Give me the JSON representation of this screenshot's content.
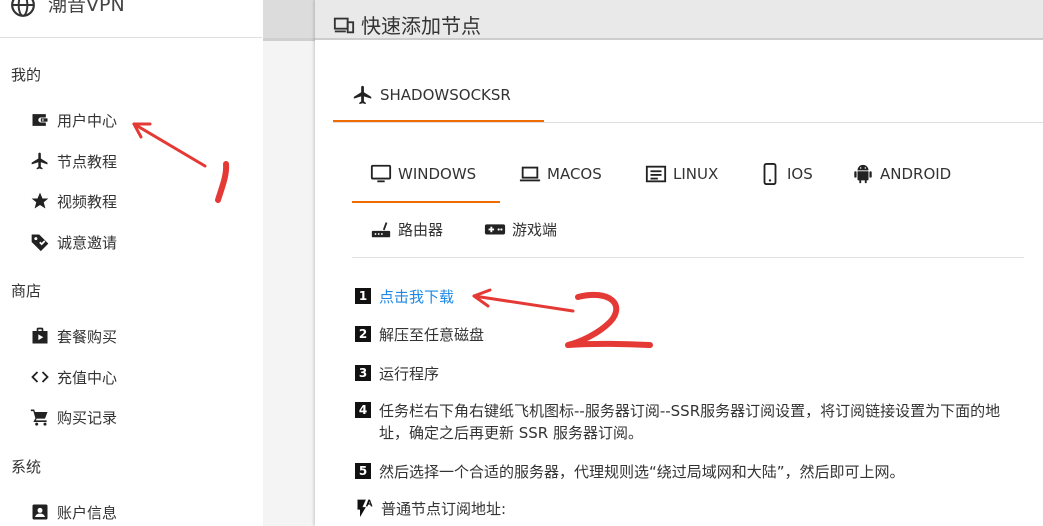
{
  "brand": {
    "name": "潮音VPN",
    "icon": "globe-icon"
  },
  "sidebar": {
    "sections": [
      {
        "title": "我的",
        "items": [
          {
            "label": "用户中心",
            "icon": "wallet-icon"
          },
          {
            "label": "节点教程",
            "icon": "airplane-icon"
          },
          {
            "label": "视频教程",
            "icon": "star-icon"
          },
          {
            "label": "诚意邀请",
            "icon": "tag-icon"
          }
        ]
      },
      {
        "title": "商店",
        "items": [
          {
            "label": "套餐购买",
            "icon": "shop-bag-icon"
          },
          {
            "label": "充值中心",
            "icon": "code-icon"
          },
          {
            "label": "购买记录",
            "icon": "cart-icon"
          }
        ]
      },
      {
        "title": "系统",
        "items": [
          {
            "label": "账户信息",
            "icon": "account-box-icon"
          }
        ]
      }
    ]
  },
  "card": {
    "title": "快速添加节点",
    "title_icon": "devices-icon",
    "protocol_tab": {
      "label": "SHADOWSOCKSR",
      "icon": "airplane-icon"
    },
    "platform_tabs": [
      {
        "label": "WINDOWS",
        "icon": "desktop-icon",
        "active": true
      },
      {
        "label": "MACOS",
        "icon": "laptop-icon"
      },
      {
        "label": "LINUX",
        "icon": "terminal-icon"
      },
      {
        "label": "IOS",
        "icon": "phone-icon"
      },
      {
        "label": "ANDROID",
        "icon": "android-icon"
      },
      {
        "label": "路由器",
        "icon": "router-icon"
      },
      {
        "label": "游戏端",
        "icon": "gamepad-icon"
      }
    ],
    "steps": [
      {
        "num": "1",
        "text": "点击我下载",
        "link": true
      },
      {
        "num": "2",
        "text": "解压至任意磁盘"
      },
      {
        "num": "3",
        "text": "运行程序"
      },
      {
        "num": "4",
        "text": "任务栏右下角右键纸飞机图标--服务器订阅--SSR服务器订阅设置，将订阅链接设置为下面的地址，确定之后再更新 SSR 服务器订阅。"
      },
      {
        "num": "5",
        "text": "然后选择一个合适的服务器，代理规则选“绕过局域网和大陆”，然后即可上网。"
      }
    ],
    "subscription_label": "普通节点订阅地址:",
    "subscription_icon": "flash-auto-icon"
  },
  "colors": {
    "accent": "#ef6c00",
    "link": "#1e88e5",
    "annotation": "#e53935"
  }
}
